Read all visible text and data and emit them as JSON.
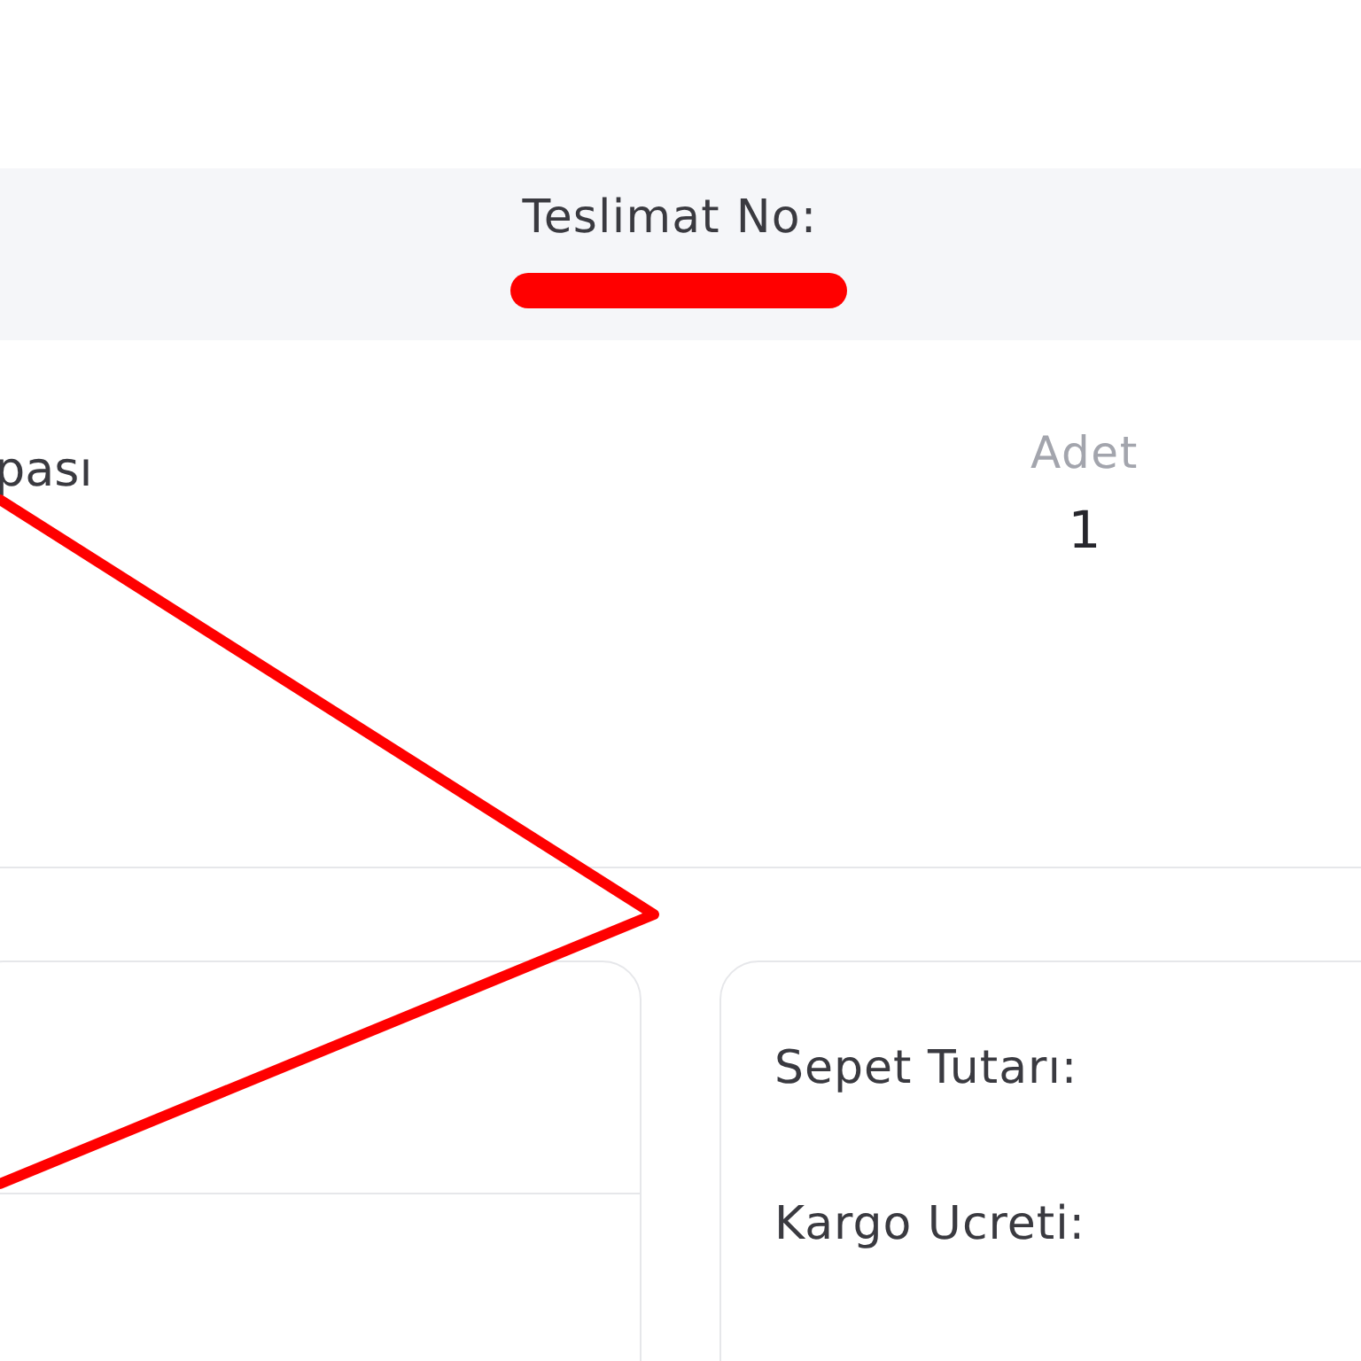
{
  "delivery": {
    "label": "Teslimat No:",
    "number_redacted": true
  },
  "product": {
    "name": "pası",
    "quantity_label": "Adet",
    "quantity": "1"
  },
  "summary": {
    "rows": [
      {
        "label": "Sepet Tutarı:"
      },
      {
        "label": "Kargo Ucreti:"
      }
    ]
  },
  "annotations": [
    {
      "kind": "chevron"
    }
  ]
}
